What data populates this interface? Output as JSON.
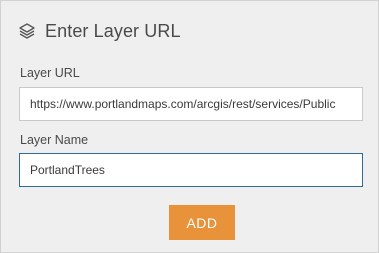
{
  "header": {
    "icon": "layers-icon",
    "title": "Enter Layer URL"
  },
  "form": {
    "url_label": "Layer URL",
    "url_value": "https://www.portlandmaps.com/arcgis/rest/services/Public",
    "name_label": "Layer Name",
    "name_value": "PortlandTrees"
  },
  "actions": {
    "add_label": "ADD"
  },
  "colors": {
    "panel_background": "#efefef",
    "accent_button": "#e8923a",
    "focus_border": "#2e6b95"
  }
}
